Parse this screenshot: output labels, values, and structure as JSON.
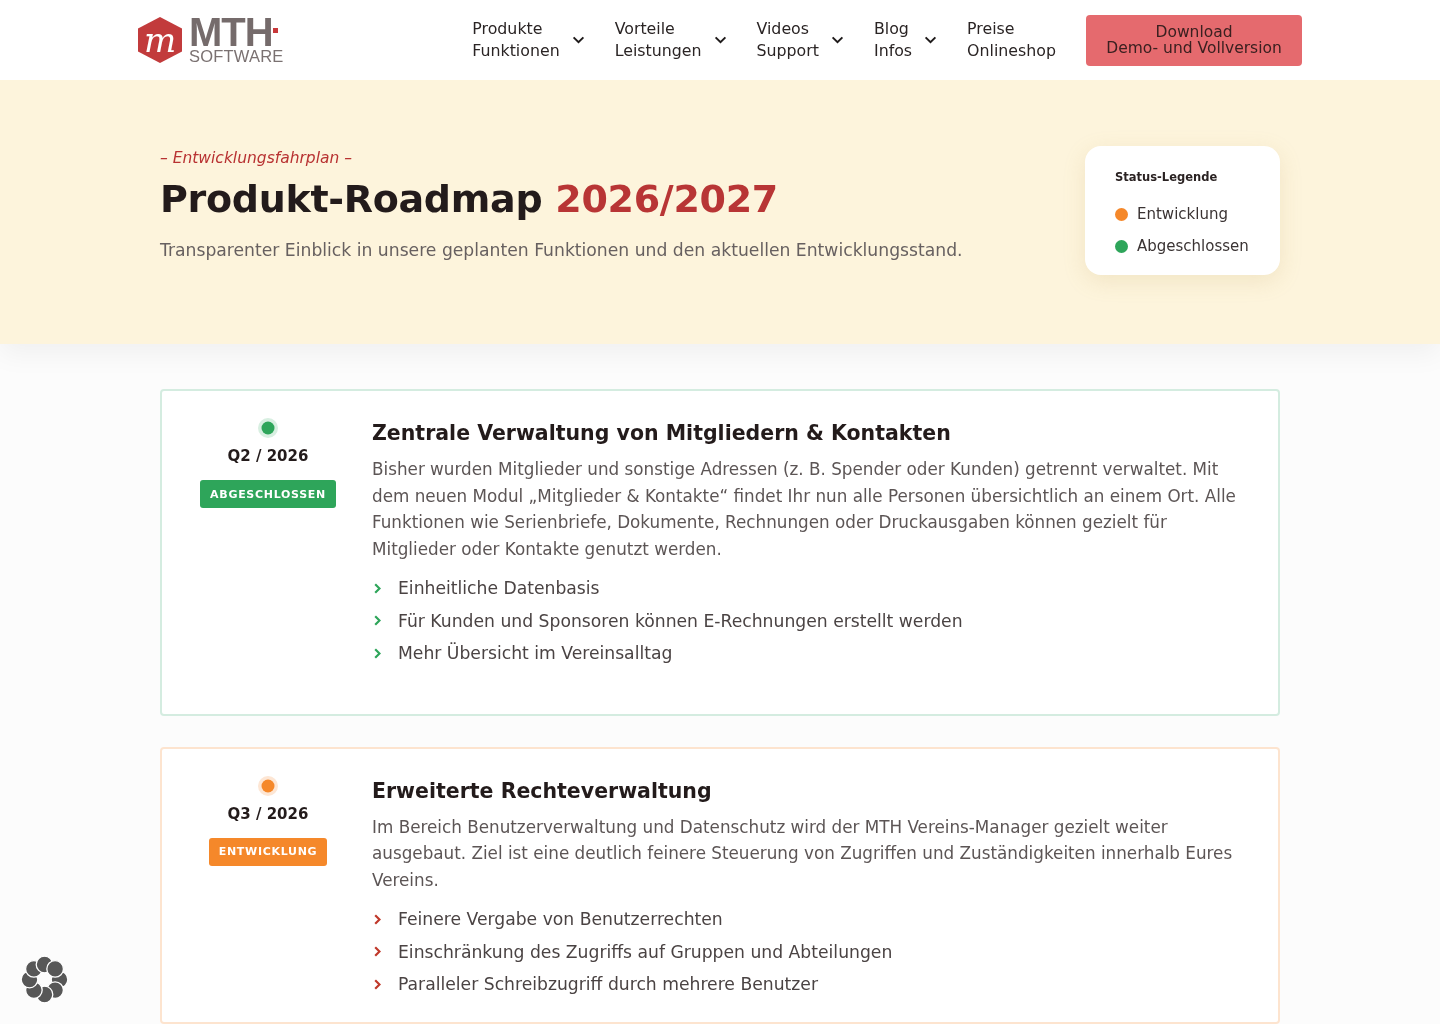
{
  "header": {
    "logo": {
      "mark": "m",
      "name": "MTH",
      "tagline": "SOFTWARE"
    },
    "nav": [
      {
        "lines": [
          "Produkte",
          "Funktionen"
        ],
        "has_menu": true
      },
      {
        "lines": [
          "Vorteile",
          "Leistungen"
        ],
        "has_menu": true
      },
      {
        "lines": [
          "Videos",
          "Support"
        ],
        "has_menu": true
      },
      {
        "lines": [
          "Blog",
          "Infos"
        ],
        "has_menu": true
      },
      {
        "lines": [
          "Preise",
          "Onlineshop"
        ],
        "has_menu": false
      }
    ],
    "cta": {
      "lines": [
        "Download",
        "Demo- und Vollversion"
      ]
    }
  },
  "hero": {
    "eyebrow": "– Entwicklungsfahrplan –",
    "title": "Produkt-Roadmap",
    "title_highlight": "2026/2027",
    "subtitle": "Transparenter Einblick in unsere geplanten Funktionen und den aktuellen Entwicklungsstand."
  },
  "legend": {
    "title": "Status-Legende",
    "items": [
      {
        "label": "Entwicklung",
        "color": "#f5882a"
      },
      {
        "label": "Abgeschlossen",
        "color": "#2ea55a"
      }
    ]
  },
  "cards": [
    {
      "kind": "completed",
      "quarter": "Q2 / 2026",
      "badge": "ABGESCHLOSSEN",
      "title": "Zentrale Verwaltung von Mitgliedern & Kontakten",
      "description": "Bisher wurden Mitglieder und sonstige Adressen (z. B. Spender oder Kunden) getrennt verwaltet. Mit dem neuen Modul „Mitglieder & Kontakte“ findet Ihr nun alle Personen übersichtlich an einem Ort. Alle Funktionen wie Serienbriefe, Dokumente, Rechnungen oder Druckausgaben können gezielt für Mitglieder oder Kontakte genutzt werden.",
      "points": [
        "Einheitliche Datenbasis",
        "Für Kunden und Sponsoren können E-Rechnungen erstellt werden",
        "Mehr Übersicht im Vereinsalltag"
      ]
    },
    {
      "kind": "development",
      "quarter": "Q3 / 2026",
      "badge": "ENTWICKLUNG",
      "title": "Erweiterte Rechteverwaltung",
      "description": "Im Bereich Benutzerverwaltung und Datenschutz wird der MTH Vereins-Manager gezielt weiter ausgebaut. Ziel ist eine deutlich feinere Steuerung von Zugriffen und Zuständigkeiten innerhalb Eures Vereins.",
      "points": [
        "Feinere Vergabe von Benutzerrechten",
        "Einschränkung des Zugriffs auf Gruppen und Abteilungen",
        "Paralleler Schreibzugriff durch mehrere Benutzer"
      ]
    }
  ]
}
